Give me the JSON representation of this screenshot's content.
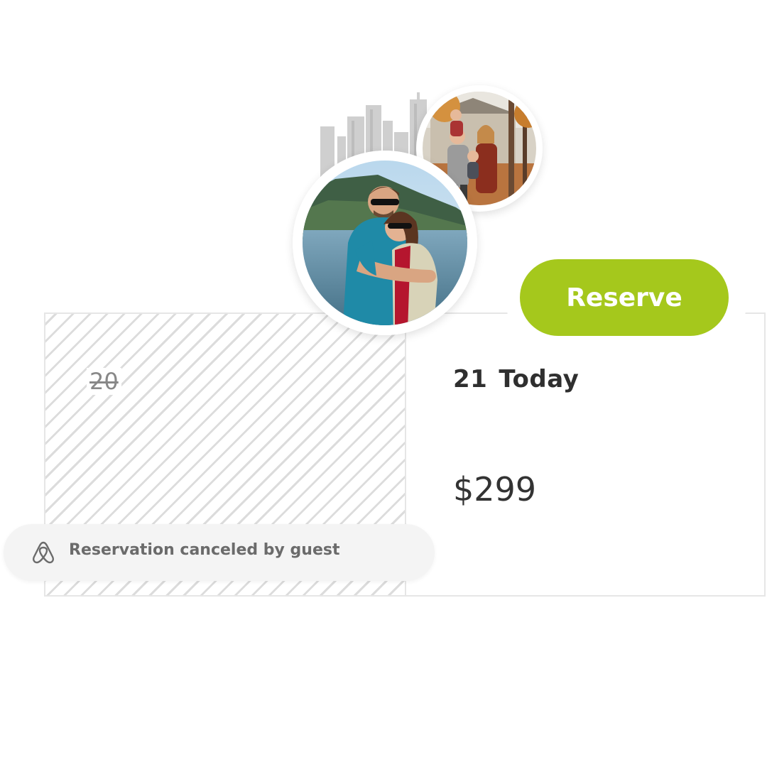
{
  "calendar": {
    "past_day": "20",
    "today_day": "21",
    "today_label": "Today",
    "price": "$299"
  },
  "reserve": {
    "label": "Reserve",
    "color": "#a5c81c"
  },
  "notice": {
    "icon": "airbnb-logo-icon",
    "text": "Reservation canceled by guest"
  },
  "avatars": [
    {
      "name": "family-avatar"
    },
    {
      "name": "couple-avatar"
    }
  ],
  "decor": {
    "skyline_icon": "city-skyline-icon"
  }
}
